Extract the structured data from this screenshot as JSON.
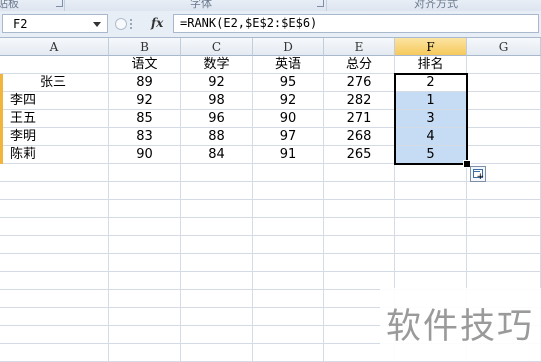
{
  "ribbon": {
    "groups": [
      "剪贴板",
      "字体",
      "对齐方式"
    ]
  },
  "formula_bar": {
    "name_box": "F2",
    "fx_label": "fx",
    "formula": "=RANK(E2,$E$2:$E$6)"
  },
  "sheet": {
    "columns": [
      "A",
      "B",
      "C",
      "D",
      "E",
      "F",
      "G"
    ],
    "active_column": "F",
    "header_row": [
      "",
      "语文",
      "数学",
      "英语",
      "总分",
      "排名",
      ""
    ],
    "rows": [
      [
        "张三",
        "89",
        "92",
        "95",
        "276",
        "2"
      ],
      [
        "李四",
        "92",
        "98",
        "92",
        "282",
        "1"
      ],
      [
        "王五",
        "85",
        "96",
        "90",
        "271",
        "3"
      ],
      [
        "李明",
        "83",
        "88",
        "97",
        "268",
        "4"
      ],
      [
        "陈莉",
        "90",
        "84",
        "91",
        "265",
        "5"
      ]
    ]
  },
  "watermark": "软件技巧"
}
